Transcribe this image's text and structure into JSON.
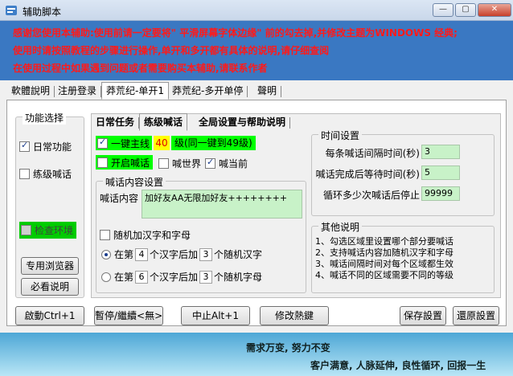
{
  "window": {
    "title": "辅助脚本",
    "minimize": "—",
    "maximize": "▢",
    "close": "✕"
  },
  "notice": {
    "line1": "感谢您使用本辅助:使用前请一定要将\" 平滑屏幕字体边缘\" 前的勾去掉,并修改主题为WINDOWS 经典;",
    "line2": "使用时请按照教程的步骤进行操作,单开和多开都有具体的说明,请仔细查阅",
    "line3": "在使用过程中如果遇到问题或者需要购买本辅助,请联系作者"
  },
  "top_tabs": [
    "軟體說明",
    "注册登录",
    "莽荒纪-单开1",
    "莽荒纪-多开单停",
    "聲明"
  ],
  "func_group": {
    "title": "功能选择",
    "daily": "日常功能",
    "shout": "练级喊话",
    "env": "检查环境",
    "browser_btn": "专用浏览器",
    "readme_btn": "必看说明"
  },
  "inner_tabs": [
    "日常任务",
    "练级喊话",
    "全局设置与帮助说明"
  ],
  "shout": {
    "mainline_label": "一键主线",
    "mainline_level": "40",
    "mainline_note": "级(同一键到49级)",
    "open_shout": "开启喊话",
    "world": "喊世界",
    "current": "喊当前"
  },
  "content_group": {
    "title": "喊话内容设置",
    "content_label": "喊话内容",
    "content_value": "加好友AA无限加好友++++++++",
    "random_cb": "随机加汉字和字母",
    "radio1_pre": "在第",
    "radio1_n1": "4",
    "radio1_mid": "个汉字后加",
    "radio1_n2": "3",
    "radio1_post": "个随机汉字",
    "radio2_pre": "在第",
    "radio2_n1": "6",
    "radio2_mid": "个汉字后加",
    "radio2_n2": "3",
    "radio2_post": "个随机字母"
  },
  "time_group": {
    "title": "时间设置",
    "interval_label": "每条喊话间隔时间(秒)",
    "interval_value": "3",
    "wait_label": "喊话完成后等待时间(秒)",
    "wait_value": "5",
    "loop_label": "循环多少次喊话后停止",
    "loop_value": "99999"
  },
  "other_group": {
    "title": "其他说明",
    "lines": [
      "1、勾选区域里设置哪个部分要喊话",
      "2、支持喊话内容加随机汉字和字母",
      "3、喊话间隔时间对每个区域都生效",
      "4、喊话不同的区域需要不同的等级"
    ]
  },
  "buttons": {
    "start": "啟動Ctrl+1",
    "pause": "暫停/繼續<無>",
    "stop": "中止Alt+1",
    "hotkey": "修改熱鍵",
    "save": "保存設置",
    "restore": "還原設置"
  },
  "footer": {
    "line1": "需求万变, 努力不变",
    "line2": "客户满意, 人脉延伸, 良性循环, 回报一生"
  },
  "colors": {
    "notice_bg": "#3a78c2",
    "notice_text": "#ff1a1a",
    "highlight_green": "#00ff00",
    "field_green": "#c8f2c8",
    "level_yellow": "#ffff00"
  }
}
